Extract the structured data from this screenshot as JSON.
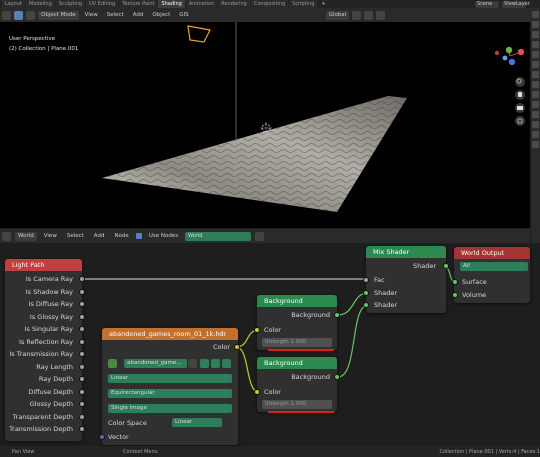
{
  "workspace_tabs": [
    "Layout",
    "Modeling",
    "Sculpting",
    "UV Editing",
    "Texture Paint",
    "Shading",
    "Animation",
    "Rendering",
    "Compositing",
    "Scripting",
    "+"
  ],
  "active_tab": "Shading",
  "top_right": {
    "scene": "Scene",
    "view_layer": "ViewLayer"
  },
  "viewport_header": {
    "mode": "Object Mode",
    "menus": [
      "View",
      "Select",
      "Add",
      "Object",
      "GIS"
    ],
    "transform": "Global"
  },
  "viewport": {
    "perspective": "User Perspective",
    "collection": "(2) Collection | Plane.001"
  },
  "node_header": {
    "type": "World",
    "menus": [
      "View",
      "Select",
      "Add",
      "Node"
    ],
    "use_nodes_label": "Use Nodes",
    "world_name": "World"
  },
  "nodes": {
    "light_path": {
      "title": "Light Path",
      "outputs": [
        "Is Camera Ray",
        "Is Shadow Ray",
        "Is Diffuse Ray",
        "Is Glossy Ray",
        "Is Singular Ray",
        "Is Reflection Ray",
        "Is Transmission Ray",
        "Ray Length",
        "Ray Depth",
        "Diffuse Depth",
        "Glossy Depth",
        "Transparent Depth",
        "Transmission Depth"
      ]
    },
    "env_texture": {
      "title": "abandoned_games_room_01_1k.hdr",
      "output": "Color",
      "image_name": "abandoned_game...",
      "interpolation": "Linear",
      "projection": "Equirectangular",
      "source": "Single Image",
      "color_space_label": "Color Space",
      "color_space": "Linear",
      "vector": "Vector"
    },
    "background1": {
      "title": "Background",
      "output": "Background",
      "input": "Color",
      "strength_label": "Strength 1.000"
    },
    "background2": {
      "title": "Background",
      "output": "Background",
      "input": "Color",
      "strength_label": "Strength 1.000"
    },
    "mix_shader": {
      "title": "Mix Shader",
      "output": "Shader",
      "inputs": [
        "Fac",
        "Shader",
        "Shader"
      ]
    },
    "world_output": {
      "title": "World Output",
      "target": "All",
      "inputs": [
        "Surface",
        "Volume"
      ]
    }
  },
  "statusbar": {
    "left": "Pan View",
    "middle": "Context Menu",
    "right": "Collection | Plane.001 | Verts:4 | Faces:1"
  },
  "colors": {
    "light_path_header": "#c23f3f",
    "texture_header": "#c4702d",
    "shader_header": "#2c8a4e",
    "output_header": "#a33535",
    "dropdown_green": "#2e7d5b"
  }
}
